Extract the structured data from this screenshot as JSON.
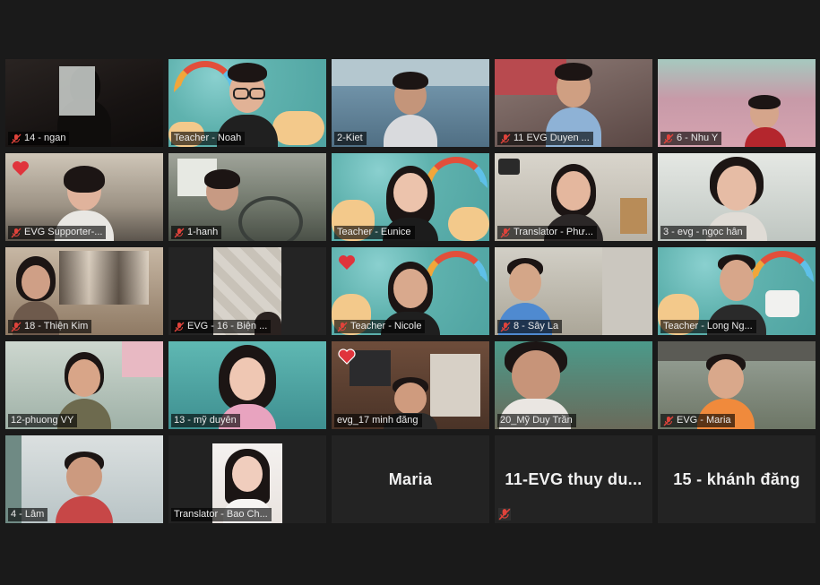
{
  "colors": {
    "background": "#1a1a1a",
    "tile_background": "#232323",
    "mute_icon": "#e0433b",
    "active_speaker": "#e6d54a",
    "heart": "#e0343c"
  },
  "participants": [
    {
      "name": "14 -  ngan",
      "muted": true,
      "type": "video"
    },
    {
      "name": "Teacher - Noah",
      "muted": false,
      "type": "video",
      "speaking": true
    },
    {
      "name": "2-Kiet",
      "muted": false,
      "type": "video"
    },
    {
      "name": "11 EVG  Duyen ...",
      "muted": true,
      "type": "video"
    },
    {
      "name": "6 - Nhu Y",
      "muted": true,
      "type": "video"
    },
    {
      "name": "EVG Supporter-...",
      "muted": true,
      "type": "video",
      "reaction": "heart"
    },
    {
      "name": "1-hanh",
      "muted": true,
      "type": "video"
    },
    {
      "name": "Teacher - Eunice",
      "muted": false,
      "type": "video"
    },
    {
      "name": "Translator - Phư...",
      "muted": true,
      "type": "video"
    },
    {
      "name": "3 - evg - ngọc hân",
      "muted": false,
      "type": "video"
    },
    {
      "name": "18 - Thiện Kim",
      "muted": true,
      "type": "video"
    },
    {
      "name": "EVG - 16 - Biện ...",
      "muted": true,
      "type": "video"
    },
    {
      "name": "Teacher - Nicole",
      "muted": true,
      "type": "video",
      "reaction": "heart"
    },
    {
      "name": "8 - Sây La",
      "muted": true,
      "type": "video"
    },
    {
      "name": "Teacher - Long Ng...",
      "muted": false,
      "type": "video"
    },
    {
      "name": "12-phuong VY",
      "muted": false,
      "type": "video"
    },
    {
      "name": "13 - mỹ duyên",
      "muted": false,
      "type": "video"
    },
    {
      "name": "evg_17 minh đăng",
      "muted": false,
      "type": "video",
      "reaction": "heart"
    },
    {
      "name": "20_Mỹ Duy Trần",
      "muted": false,
      "type": "video"
    },
    {
      "name": "EVG - Maria",
      "muted": true,
      "type": "video"
    },
    {
      "name": "4 - Lâm",
      "muted": false,
      "type": "video"
    },
    {
      "name": "Translator - Bao Ch...",
      "muted": false,
      "type": "photo"
    },
    {
      "name": "Maria",
      "muted": false,
      "type": "no-video",
      "active": true
    },
    {
      "name": "11-EVG  thuy du...",
      "muted": true,
      "type": "no-video"
    },
    {
      "name": "15 - khánh đăng",
      "muted": false,
      "type": "no-video"
    }
  ]
}
